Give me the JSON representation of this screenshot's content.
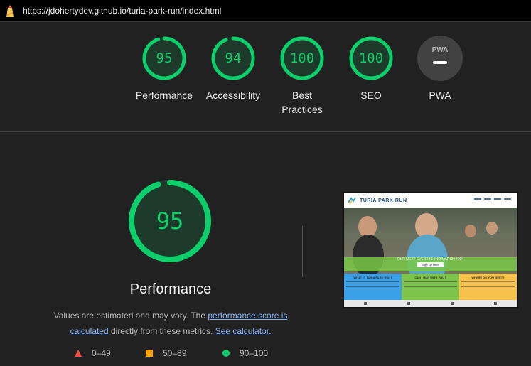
{
  "browser": {
    "url": "https://jdohertydev.github.io/turia-park-run/index.html"
  },
  "scores": [
    {
      "label": "Performance",
      "value": "95",
      "fraction": 0.95
    },
    {
      "label": "Accessibility",
      "value": "94",
      "fraction": 0.94
    },
    {
      "label": "Best Practices",
      "value": "100",
      "fraction": 1.0
    },
    {
      "label": "SEO",
      "value": "100",
      "fraction": 1.0
    },
    {
      "label": "PWA",
      "badge": "PWA"
    }
  ],
  "performance": {
    "score": "95",
    "fraction": 0.95,
    "title": "Performance",
    "desc_prefix": "Values are estimated and may vary. The ",
    "link_score": "performance score is calculated",
    "desc_middle": " directly from these metrics. ",
    "link_calc": "See calculator."
  },
  "legend": [
    {
      "range": "0–49",
      "color": "#ff4e42",
      "icon": "triangle-icon"
    },
    {
      "range": "50–89",
      "color": "#ffa400",
      "icon": "square-icon"
    },
    {
      "range": "90–100",
      "color": "#0cce6b",
      "icon": "circle-icon"
    }
  ],
  "screenshot": {
    "brand": "TURIA PARK RUN",
    "banner": "OUR NEXT EVENT IS 2ND MARCH 2024",
    "button": "Sign Up Here",
    "col1": "WHAT IS TURIA PARK RUN?",
    "col2": "CAN I RUN WITH YOU?",
    "col3": "WHERE DO YOU MEET?"
  },
  "colors": {
    "pass": "#0cce6b",
    "track": "#1e3a2b",
    "pwa_bg": "#424242"
  }
}
